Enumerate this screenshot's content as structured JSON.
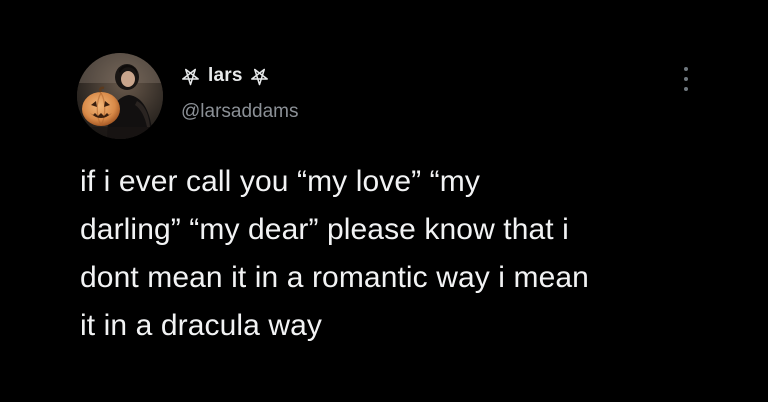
{
  "tweet": {
    "author": {
      "display_name": "lars",
      "handle": "@larsaddams",
      "name_decoration_icon": "inverted-pentagram-icon"
    },
    "more_icon": "more-vertical-icon",
    "text_lines": [
      "if i ever call you “my love” “my",
      "darling” “my dear” please know that i",
      "dont mean it in a romantic way i mean",
      "it in a dracula way"
    ]
  },
  "colors": {
    "background": "#000000",
    "primary_text": "#e7e9ea",
    "secondary_text": "#8b9096"
  }
}
